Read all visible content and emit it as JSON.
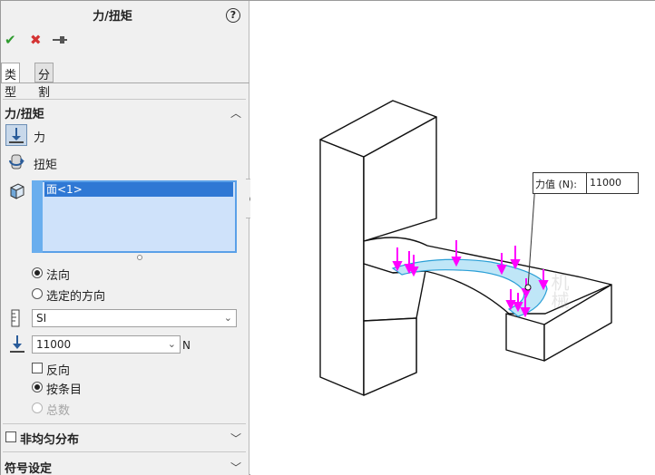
{
  "panel": {
    "title": "力/扭矩",
    "help_symbol": "?",
    "actions": {
      "ok_icon": "check-icon",
      "cancel_icon": "close-icon",
      "pin_icon": "pin-icon"
    },
    "tabs": [
      {
        "label": "类型"
      },
      {
        "label": "分割"
      }
    ],
    "force_section": {
      "title": "力/扭矩",
      "types": [
        {
          "label": "力",
          "icon": "force-arrow-icon",
          "selected": true
        },
        {
          "label": "扭矩",
          "icon": "torque-icon",
          "selected": false
        }
      ],
      "selection_items": [
        "面<1>"
      ],
      "direction_options": [
        {
          "label": "法向",
          "selected": true
        },
        {
          "label": "选定的方向",
          "selected": false
        }
      ],
      "unit_system": "SI",
      "force_value": "11000",
      "force_unit": "N",
      "reverse_label": "反向",
      "per_item_label": "按条目",
      "total_label": "总数"
    },
    "nonuniform_label": "非均匀分布",
    "symbol_settings_label": "符号设定"
  },
  "viewport": {
    "callout_label": "力值 (N):",
    "callout_value": "11000",
    "load_color": "#ff00ff",
    "face_color": "#bfe6f7",
    "watermark": "机械"
  }
}
